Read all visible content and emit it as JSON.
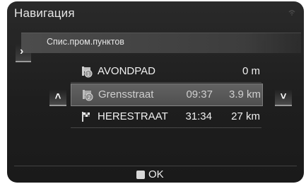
{
  "header": {
    "title": "Навигация"
  },
  "list": {
    "subtitle": "Спис.пром.пунктов",
    "rows": [
      {
        "name": "AVONDPAD",
        "time": "",
        "distance": "0 m",
        "icon": "waypoint-1-icon",
        "selected": false
      },
      {
        "name": "Grensstraat",
        "time": "09:37",
        "distance": "3.9 km",
        "icon": "waypoint-2-icon",
        "selected": true
      },
      {
        "name": "HERESTRAAT",
        "time": "31:34",
        "distance": "27 km",
        "icon": "destination-flag-icon",
        "selected": false
      }
    ]
  },
  "footer": {
    "ok_label": "OK"
  },
  "colors": {
    "background": "#1e1e1e",
    "text": "#f0f0f0",
    "selected_row": "#5a5a5a"
  }
}
